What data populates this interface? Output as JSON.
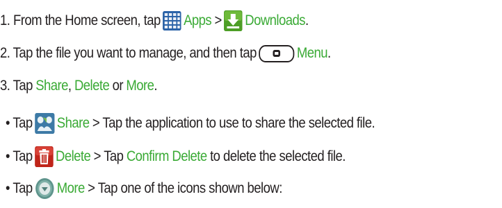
{
  "steps": {
    "step1": {
      "prefix": "1. From the Home screen, tap",
      "apps_label": "Apps",
      "separator": ">",
      "downloads_label": "Downloads",
      "suffix": "."
    },
    "step2": {
      "prefix": "2. Tap the file you want to manage, and then tap",
      "menu_label": "Menu",
      "suffix": "."
    },
    "step3": {
      "prefix": "3. Tap",
      "share": "Share",
      "comma": ",",
      "delete": "Delete",
      "or": "or",
      "more": "More",
      "suffix": "."
    }
  },
  "bullets": [
    {
      "bullet": "•",
      "tap": "Tap",
      "label": "Share",
      "middle": "> Tap the application to use to share the selected file.",
      "icon": "share-icon"
    },
    {
      "bullet": "•",
      "tap": "Tap",
      "label": "Delete",
      "middle_pre": "> Tap",
      "link": "Confirm Delete",
      "middle_post": "to delete the selected file.",
      "icon": "delete-icon"
    },
    {
      "bullet": "•",
      "tap": "Tap",
      "label": "More",
      "middle": "> Tap one of the icons shown below:",
      "icon": "more-icon"
    }
  ],
  "colors": {
    "text": "#231f20",
    "accent_green": "#3aaa35"
  }
}
